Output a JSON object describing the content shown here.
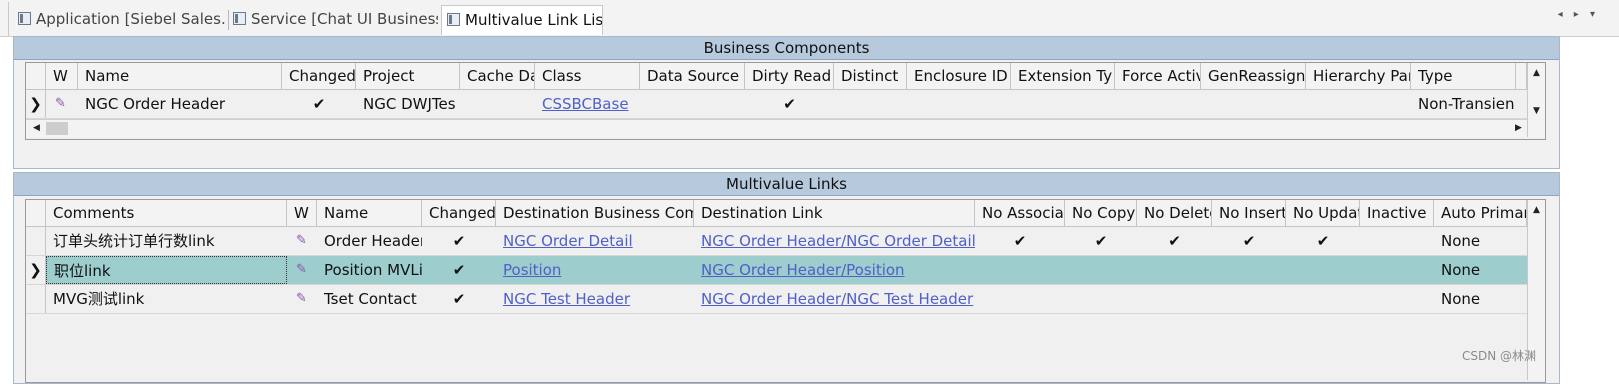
{
  "tabs": [
    {
      "label": "Application [Siebel Sales...",
      "icon": "document-icon"
    },
    {
      "label": "Service [Chat UI Business...",
      "icon": "document-icon"
    },
    {
      "label": "Multivalue Link List",
      "icon": "document-icon"
    }
  ],
  "tab_nav": "◂ ▸ ▾",
  "bc_panel": {
    "title": "Business Components",
    "columns": [
      "W",
      "Name",
      "Changed",
      "Project",
      "Cache Da",
      "Class",
      "Data Source",
      "Dirty Read",
      "Distinct",
      "Enclosure ID",
      "Extension Ty",
      "Force Activ",
      "GenReassign.",
      "Hierarchy Par",
      "Type",
      ""
    ],
    "rows": [
      {
        "selector": "❯",
        "w": "✎",
        "name": "NGC Order Header",
        "changed": "✔",
        "project": "NGC DWJTes",
        "cache": "",
        "class": "CSSBCBase",
        "data_source": "",
        "dirty_read": "✔",
        "distinct": "",
        "enclosure": "",
        "extension": "",
        "force": "",
        "genreassign": "",
        "hierarchy": "",
        "type": "Non-Transien"
      }
    ]
  },
  "mvl_panel": {
    "title": "Multivalue Links",
    "columns": [
      "Comments",
      "W",
      "Name",
      "Changed",
      "Destination Business Comp",
      "Destination Link",
      "No Associa",
      "No Copy",
      "No Delete",
      "No Insert",
      "No Updat",
      "Inactive",
      "Auto Primary"
    ],
    "rows": [
      {
        "selector": "",
        "comments": "订单头统计订单行数link",
        "w": "✎",
        "name": "Order Header",
        "changed": "✔",
        "dest_bc": "NGC Order Detail",
        "dest_link": "NGC Order Header/NGC Order Detail",
        "no_assoc": "✔",
        "no_copy": "✔",
        "no_delete": "✔",
        "no_insert": "✔",
        "no_update": "✔",
        "inactive": "",
        "auto_primary": "None"
      },
      {
        "selector": "❯",
        "comments": "职位link",
        "w": "✎",
        "name": "Position MVLi",
        "changed": "✔",
        "dest_bc": "Position",
        "dest_link": "NGC Order Header/Position",
        "no_assoc": "",
        "no_copy": "",
        "no_delete": "",
        "no_insert": "",
        "no_update": "",
        "inactive": "",
        "auto_primary": "None"
      },
      {
        "selector": "",
        "comments": "MVG测试link",
        "w": "✎",
        "name": "Tset Contact",
        "changed": "✔",
        "dest_bc": "NGC Test Header",
        "dest_link": "NGC Order Header/NGC Test Header",
        "no_assoc": "",
        "no_copy": "",
        "no_delete": "",
        "no_insert": "",
        "no_update": "",
        "inactive": "",
        "auto_primary": "None"
      }
    ]
  },
  "watermark": "CSDN @林渊"
}
